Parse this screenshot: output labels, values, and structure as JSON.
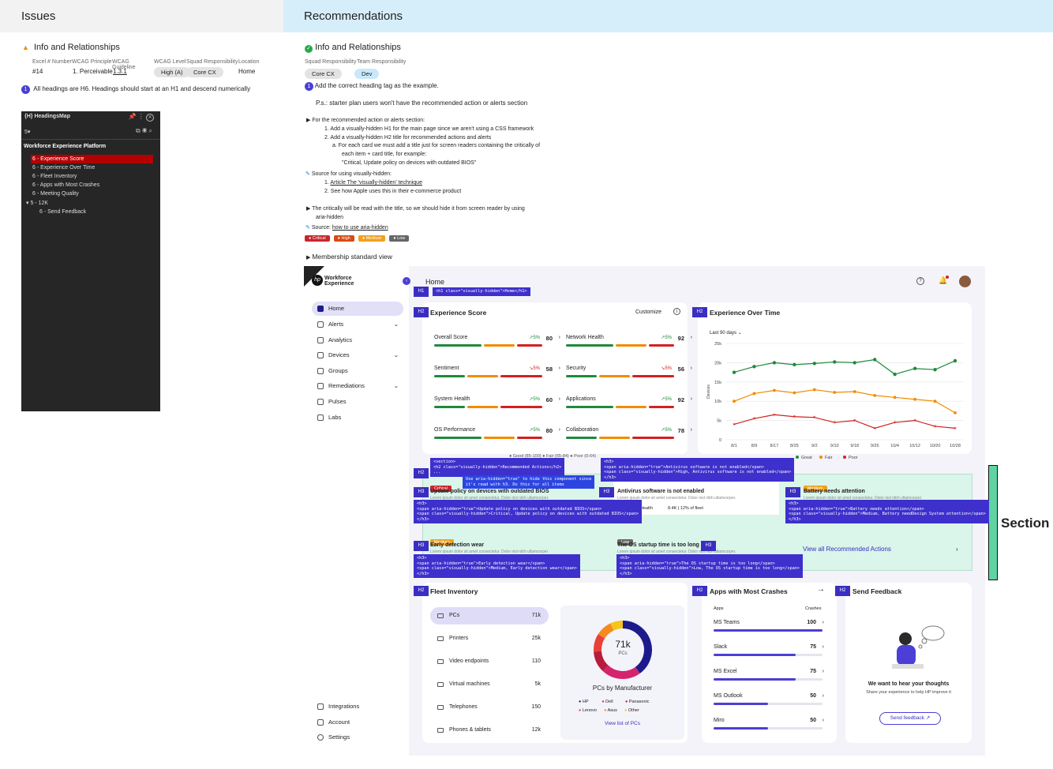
{
  "issues": {
    "title": "Issues",
    "section_title": "Info and Relationships",
    "meta_labels": [
      "Excel # Number",
      "WCAG Principle",
      "WCAG Guideline",
      "WCAG Level",
      "Squad Responsibility",
      "Location"
    ],
    "meta_values": [
      "#14",
      "1. Perceivable",
      "1.3.1",
      "High (A)",
      "Core CX",
      "Home"
    ],
    "note": "All headings are H6. Headings should start at an H1 and descend numerically"
  },
  "headingsmap": {
    "title": "HeadingsMap",
    "level": "5▾",
    "page": "Workforce Experience Platform",
    "items": [
      "6 - Experience Score",
      "6 - Experience Over Time",
      "6 - Fleet Inventory",
      "6 - Apps with Most Crashes",
      "6 - Meeting Quality",
      "5 - 12K",
      "6 - Send Feedback"
    ]
  },
  "recs": {
    "title": "Recommendations",
    "section_title": "Info and Relationships",
    "meta_labels": [
      "Squad Responsibility",
      "Team Responsibility"
    ],
    "meta_values": [
      "Core CX",
      "Dev"
    ],
    "step1": "Add the correct heading tag as the example.",
    "ps": "P.s.: starter plan users won't have the recommended action or alerts section",
    "b1": "For the recommended action or alerts section:",
    "b1_1": "1. Add a visually-hidden H1 for the main page since we aren't using a CSS framework",
    "b1_2": "2. Add a visually-hidden H2 title for recommended actions and alerts",
    "b1_3": "a. For each card we must add a title just for screen readers containing the critically of",
    "b1_4": "each item + card title, for example:",
    "b1_5": "\"Critical, Update policy on devices with outdated BIOS\"",
    "src": "Source for using visually-hidden:",
    "src1_pre": "1. ",
    "src1_link": "Article The 'visually-hidden' technique",
    "src2": "2. See how Apple uses this in their e-commerce product",
    "b2": "The critically will be read with the title, so we should hide it from screen reader by using",
    "b2b": "aria-hidden",
    "src3_pre": "Source: ",
    "src3_link": "how to use aria-hidden",
    "badges": [
      "Critical",
      "High",
      "Medium",
      "Low"
    ],
    "membership": "Membership standard view",
    "section_label": "Section"
  },
  "app": {
    "logo1": "Workforce",
    "logo2": "Experience",
    "page": "Home",
    "nav": [
      "Home",
      "Alerts",
      "Analytics",
      "Devices",
      "Groups",
      "Remediations",
      "Pulses",
      "Labs"
    ],
    "nav_bottom": [
      "Integrations",
      "Account",
      "Settings"
    ],
    "tags": {
      "h1": "H1",
      "h2": "H2",
      "h3": "H3"
    },
    "h1_code": "<h1 class=\"visually-hidden\">Home</h1>",
    "exp_score": {
      "title": "Experience Score",
      "customize": "Customize",
      "items": [
        {
          "l": "Overall Score",
          "t": "↗5%",
          "v": "80"
        },
        {
          "l": "Network Health",
          "t": "↗5%",
          "v": "92"
        },
        {
          "l": "Sentiment",
          "t": "↘5%",
          "v": "58"
        },
        {
          "l": "Security",
          "t": "↘5%",
          "v": "56"
        },
        {
          "l": "System Health",
          "t": "↗5%",
          "v": "60"
        },
        {
          "l": "Applications",
          "t": "↗5%",
          "v": "92"
        },
        {
          "l": "OS Performance",
          "t": "↗5%",
          "v": "80"
        },
        {
          "l": "Collaboration",
          "t": "↗5%",
          "v": "78"
        }
      ],
      "legend": "● Good (85-100)  ● Fair (65-84)  ● Poor (0-64)"
    },
    "exp_time": {
      "title": "Experience Over Time",
      "range": "Last 90 days",
      "ylabel": "Devices",
      "legend": [
        "Great",
        "Fair",
        "Poor"
      ]
    },
    "rec_actions": {
      "code_section": "<section>\n<h2 class=\"visually-hidden\">Recommended Actions</h2>\n...",
      "code_hide": "Use aria-hidden=\"true\" to hide this component since\nit's read with h3. Do this for all items",
      "code_antivirus": "<h3>\n<span aria-hidden=\"true\">Antivirus software is not enabled</span>\n<span class=\"visually-hidden\">High, Antivirus software is not enabled</span>\n</h3>",
      "code_update": "<h3>\n<span aria-hidden=\"true\">Update policy on devices with outdated BIOS</span>\n<span class=\"visually-hidden\">Critical, Update policy on devices with outdated BIOS</span>\n</h3>",
      "code_battery": "<h3>\n<span aria-hidden=\"true\">Battery needs attention</span>\n<span class=\"visually-hidden\">Medium, Battery needDesign System attention</span>\n</h3>",
      "code_wear": "<h3>\n<span aria-hidden=\"true\">Early detection wear</span>\n<span class=\"visually-hidden\">Medium, Early detection wear</span>\n</h3>",
      "code_startup": "<h3>\n<span aria-hidden=\"true\">The OS startup time is too long</span>\n<span class=\"visually-hidden\">Low, The OS startup time is too long</span>\n</h3>",
      "cards": [
        {
          "sev": "Critical",
          "title": "Update policy on devices with outdated BIOS"
        },
        {
          "sev": "High",
          "title": "Antivirus software is not enabled"
        },
        {
          "sev": "Medium",
          "title": "Battery needs attention"
        },
        {
          "sev": "Medium",
          "title": "Early detection wear"
        },
        {
          "sev": "Low",
          "title": "The OS startup time is too long"
        }
      ],
      "lorem": "Lorem ipsum dolor sit amet consectetur. Dolor nisl nibh ullamcorper.",
      "health": "Health",
      "stat": "8.4K | 12% of fleet",
      "view_all": "View all Recommended Actions"
    },
    "fleet": {
      "title": "Fleet Inventory",
      "items": [
        {
          "l": "PCs",
          "n": "71k"
        },
        {
          "l": "Printers",
          "n": "25k"
        },
        {
          "l": "Video endpoints",
          "n": "110"
        },
        {
          "l": "Virtual machines",
          "n": "5k"
        },
        {
          "l": "Telephones",
          "n": "150"
        },
        {
          "l": "Phones & tablets",
          "n": "12k"
        }
      ],
      "donut_value": "71k",
      "donut_label": "PCs",
      "donut_title": "PCs by Manufacturer",
      "mfr": [
        "HP",
        "Dell",
        "Panasonic",
        "Lenovo",
        "Asus",
        "Other"
      ],
      "link": "View list of PCs"
    },
    "crashes": {
      "title": "Apps with Most Crashes",
      "col1": "Apps",
      "col2": "Crashes",
      "items": [
        {
          "l": "MS Teams",
          "n": "100",
          "f": 1.0
        },
        {
          "l": "Slack",
          "n": "75",
          "f": 0.75
        },
        {
          "l": "MS Excel",
          "n": "75",
          "f": 0.75
        },
        {
          "l": "MS Outlook",
          "n": "50",
          "f": 0.5
        },
        {
          "l": "Miro",
          "n": "50",
          "f": 0.5
        }
      ]
    },
    "feedback": {
      "title": "Send Feedback",
      "heading": "We want to hear your thoughts",
      "text": "Share your experience to help HP improve it",
      "button": "Send feedback"
    }
  },
  "chart_data": {
    "type": "line",
    "x": [
      "8/1",
      "8/9",
      "8/17",
      "8/25",
      "9/2",
      "9/10",
      "9/18",
      "9/26",
      "10/4",
      "10/12",
      "10/20",
      "10/28"
    ],
    "ylim": [
      0,
      25000
    ],
    "yticks": [
      "0",
      "5k",
      "10k",
      "15k",
      "20k",
      "25k"
    ],
    "ylabel": "Devices",
    "series": [
      {
        "name": "Great",
        "color": "#1e8a3c",
        "values": [
          17500,
          19000,
          20000,
          19500,
          19800,
          20200,
          20000,
          20800,
          17000,
          18500,
          18200,
          20500
        ]
      },
      {
        "name": "Fair",
        "color": "#f08c00",
        "values": [
          10000,
          12000,
          12800,
          12200,
          13000,
          12300,
          12500,
          11500,
          11000,
          10500,
          10000,
          7000
        ]
      },
      {
        "name": "Poor",
        "color": "#d42020",
        "values": [
          4000,
          5500,
          6500,
          6000,
          5800,
          4500,
          5000,
          3000,
          4500,
          5000,
          3500,
          3000
        ]
      }
    ]
  },
  "donut": [
    {
      "color": "#1d1b8c",
      "v": 40
    },
    {
      "color": "#d5246e",
      "v": 22
    },
    {
      "color": "#b81c3c",
      "v": 12
    },
    {
      "color": "#e8413a",
      "v": 10
    },
    {
      "color": "#f58a1f",
      "v": 9
    },
    {
      "color": "#f5c518",
      "v": 7
    }
  ]
}
